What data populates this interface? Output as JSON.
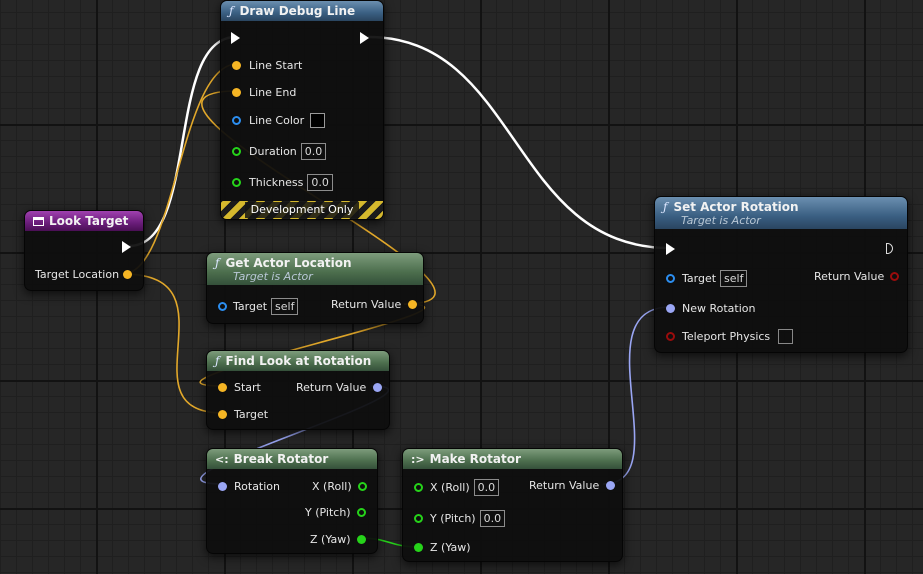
{
  "nodes": {
    "draw_debug_line": {
      "title": "Draw Debug Line",
      "pins": {
        "line_start": "Line Start",
        "line_end": "Line End",
        "line_color": "Line Color",
        "duration": "Duration",
        "thickness": "Thickness"
      },
      "values": {
        "duration": "0.0",
        "thickness": "0.0"
      },
      "footer": "Development Only"
    },
    "look_target": {
      "title": "Look Target",
      "pins": {
        "target_location": "Target Location"
      }
    },
    "get_actor_location": {
      "title": "Get Actor Location",
      "subtitle": "Target is Actor",
      "pins": {
        "target": "Target",
        "return_value": "Return Value"
      },
      "values": {
        "target": "self"
      }
    },
    "find_look_at_rotation": {
      "title": "Find Look at Rotation",
      "pins": {
        "start": "Start",
        "target": "Target",
        "return_value": "Return Value"
      }
    },
    "break_rotator": {
      "title": "Break Rotator",
      "pins": {
        "rotation": "Rotation",
        "x": "X (Roll)",
        "y": "Y (Pitch)",
        "z": "Z (Yaw)"
      }
    },
    "make_rotator": {
      "title": "Make Rotator",
      "pins": {
        "x": "X (Roll)",
        "y": "Y (Pitch)",
        "z": "Z (Yaw)",
        "return_value": "Return Value"
      },
      "values": {
        "x": "0.0",
        "y": "0.0"
      }
    },
    "set_actor_rotation": {
      "title": "Set Actor Rotation",
      "subtitle": "Target is Actor",
      "pins": {
        "target": "Target",
        "new_rotation": "New Rotation",
        "teleport_physics": "Teleport Physics",
        "return_value": "Return Value"
      },
      "values": {
        "target": "self"
      }
    }
  },
  "icons": {
    "function": "function-icon",
    "event": "event-icon",
    "break": "break-struct-icon",
    "make": "make-struct-icon"
  },
  "colors": {
    "exec": "#ffffff",
    "vector": "#f5b524",
    "rotator": "#9aa6f4",
    "float": "#26d31a",
    "object": "#2c8ef0",
    "bool": "#9a0c0c"
  }
}
